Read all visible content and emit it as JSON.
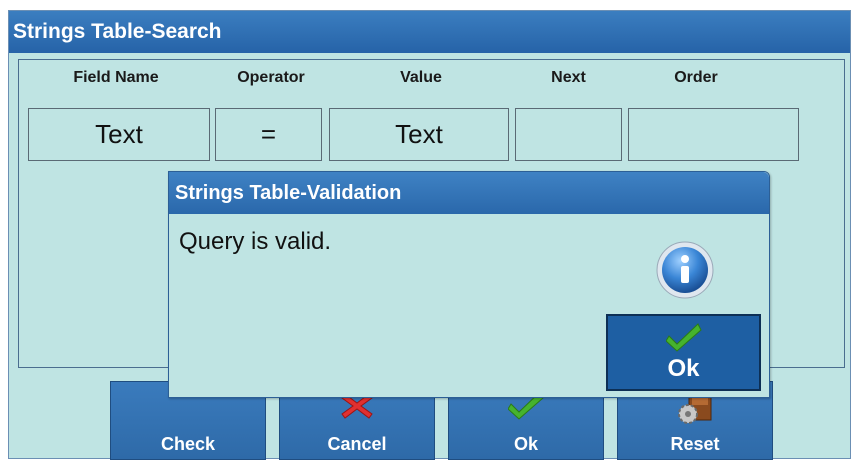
{
  "window": {
    "title": "Strings Table-Search"
  },
  "columns": [
    "Field Name",
    "Operator",
    "Value",
    "Next",
    "Order"
  ],
  "row": {
    "field_name": "Text",
    "operator": "=",
    "value": "Text",
    "next": "",
    "order": ""
  },
  "buttons": {
    "check": {
      "label": "Check",
      "icon": "none"
    },
    "cancel": {
      "label": "Cancel",
      "icon": "red-x-icon"
    },
    "ok": {
      "label": "Ok",
      "icon": "green-check-icon"
    },
    "reset": {
      "label": "Reset",
      "icon": "reset-gear-icon"
    }
  },
  "dialog": {
    "title": "Strings Table-Validation",
    "message": "Query is valid.",
    "icon": "info-icon",
    "ok_label": "Ok"
  },
  "colors": {
    "background": "#bfe4e3",
    "titlebar": "#2a68ab",
    "button": "#3371b2",
    "cancel_icon": "#e03030",
    "check_icon": "#46b32e"
  }
}
